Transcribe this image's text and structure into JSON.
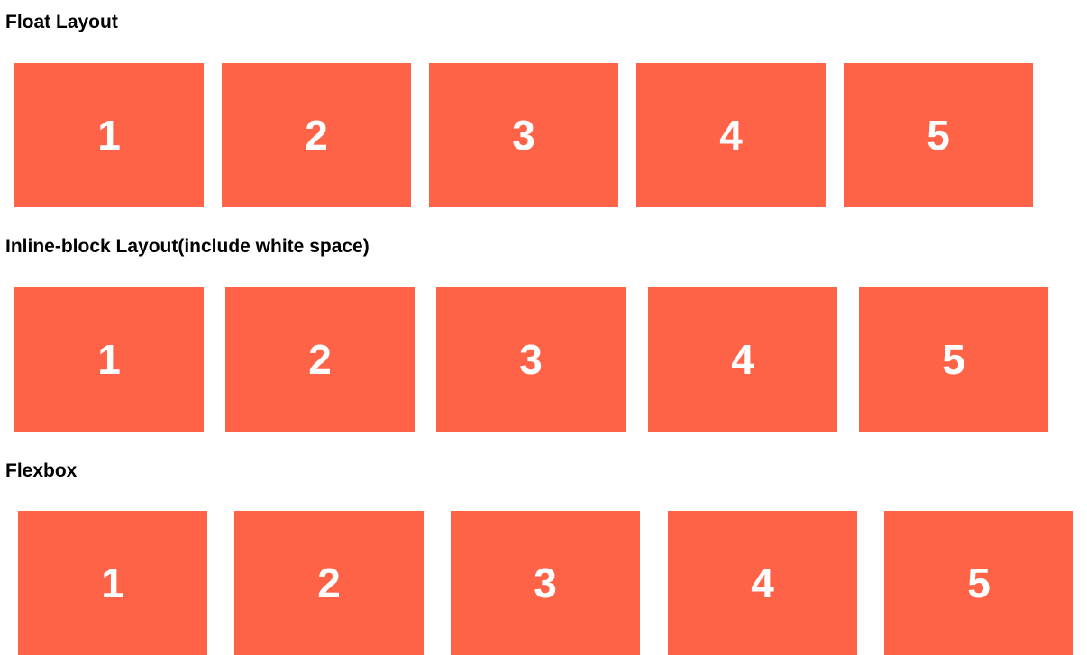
{
  "accent_color": "#FF6347",
  "sections": [
    {
      "title": "Float Layout",
      "boxes": [
        "1",
        "2",
        "3",
        "4",
        "5"
      ]
    },
    {
      "title": "Inline-block Layout(include white space)",
      "boxes": [
        "1",
        "2",
        "3",
        "4",
        "5"
      ]
    },
    {
      "title": "Flexbox",
      "boxes": [
        "1",
        "2",
        "3",
        "4",
        "5"
      ]
    }
  ]
}
